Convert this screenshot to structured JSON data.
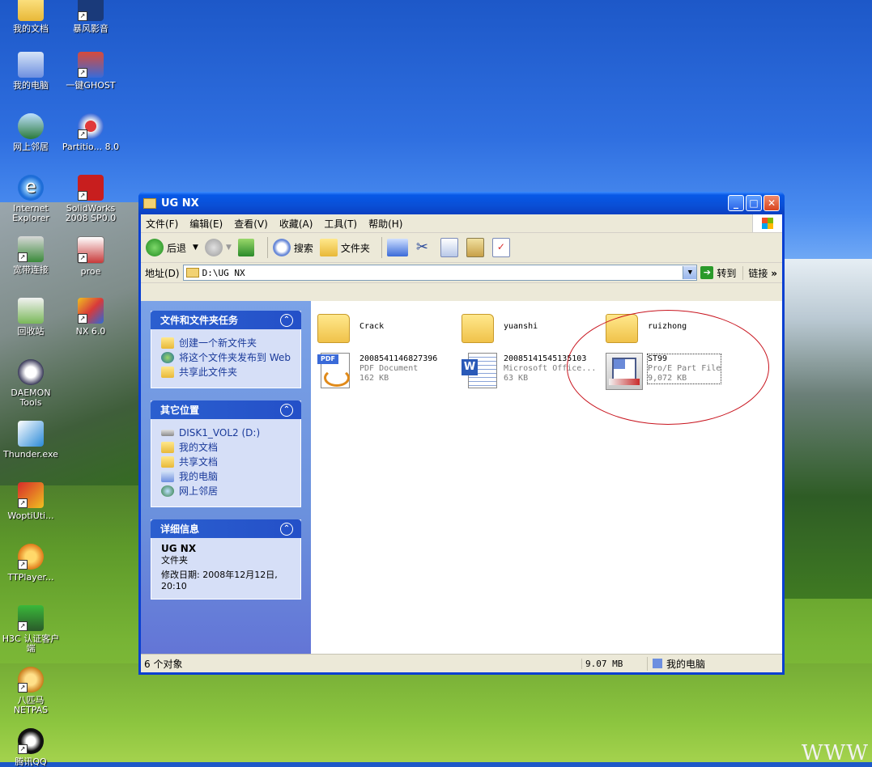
{
  "desktop": {
    "icons": [
      {
        "label": "我的文档",
        "name": "my-documents"
      },
      {
        "label": "暴风影音",
        "name": "storm-player"
      },
      {
        "label": "我的电脑",
        "name": "my-computer"
      },
      {
        "label": "一键GHOST",
        "name": "ghost"
      },
      {
        "label": "网上邻居",
        "name": "network-places"
      },
      {
        "label": "Partitio... 8.0",
        "name": "partition"
      },
      {
        "label": "Internet Explorer",
        "name": "internet-explorer"
      },
      {
        "label": "SolidWorks 2008 SP0.0",
        "name": "solidworks"
      },
      {
        "label": "宽带连接",
        "name": "broadband"
      },
      {
        "label": "proe",
        "name": "proe"
      },
      {
        "label": "回收站",
        "name": "recycle-bin"
      },
      {
        "label": "NX 6.0",
        "name": "nx"
      },
      {
        "label": "DAEMON Tools",
        "name": "daemon-tools"
      },
      {
        "label": "Thunder.exe",
        "name": "thunder"
      },
      {
        "label": "WoptiUti...",
        "name": "wopti"
      },
      {
        "label": "TTPlayer...",
        "name": "ttplayer"
      },
      {
        "label": "H3C 认证客户端",
        "name": "h3c"
      },
      {
        "label": "八匹马 NETPAS",
        "name": "netpas"
      },
      {
        "label": "腾讯QQ",
        "name": "qq"
      }
    ],
    "watermark": "WWW"
  },
  "window": {
    "title": "UG NX",
    "menu": [
      "文件(F)",
      "编辑(E)",
      "查看(V)",
      "收藏(A)",
      "工具(T)",
      "帮助(H)"
    ],
    "toolbar": {
      "back": "后退",
      "search": "搜索",
      "folders": "文件夹"
    },
    "address": {
      "label": "地址(D)",
      "path": "D:\\UG NX",
      "goto": "转到",
      "links": "链接"
    },
    "tasks": {
      "title": "文件和文件夹任务",
      "items": [
        "创建一个新文件夹",
        "将这个文件夹发布到 Web",
        "共享此文件夹"
      ]
    },
    "places": {
      "title": "其它位置",
      "items": [
        "DISK1_VOL2 (D:)",
        "我的文档",
        "共享文档",
        "我的电脑",
        "网上邻居"
      ]
    },
    "details": {
      "title": "详细信息",
      "name": "UG NX",
      "type": "文件夹",
      "modified": "修改日期: 2008年12月12日, 20:10"
    },
    "files": [
      {
        "name": "Crack",
        "kind": "folder"
      },
      {
        "name": "yuanshi",
        "kind": "folder"
      },
      {
        "name": "ruizhong",
        "kind": "folder"
      },
      {
        "name": "2008541146827396",
        "type": "PDF Document",
        "size": "162 KB",
        "kind": "pdf"
      },
      {
        "name": "20085141545135103",
        "type": "Microsoft Office...",
        "size": "63 KB",
        "kind": "doc"
      },
      {
        "name": "ST99",
        "type": "Pro/E Part File",
        "size": "9,072 KB",
        "kind": "prt"
      }
    ],
    "status": {
      "count": "6 个对象",
      "size": "9.07 MB",
      "location": "我的电脑"
    }
  },
  "colors": {
    "annotation": "#c8141e",
    "titlebar": "#0a4fd6"
  }
}
